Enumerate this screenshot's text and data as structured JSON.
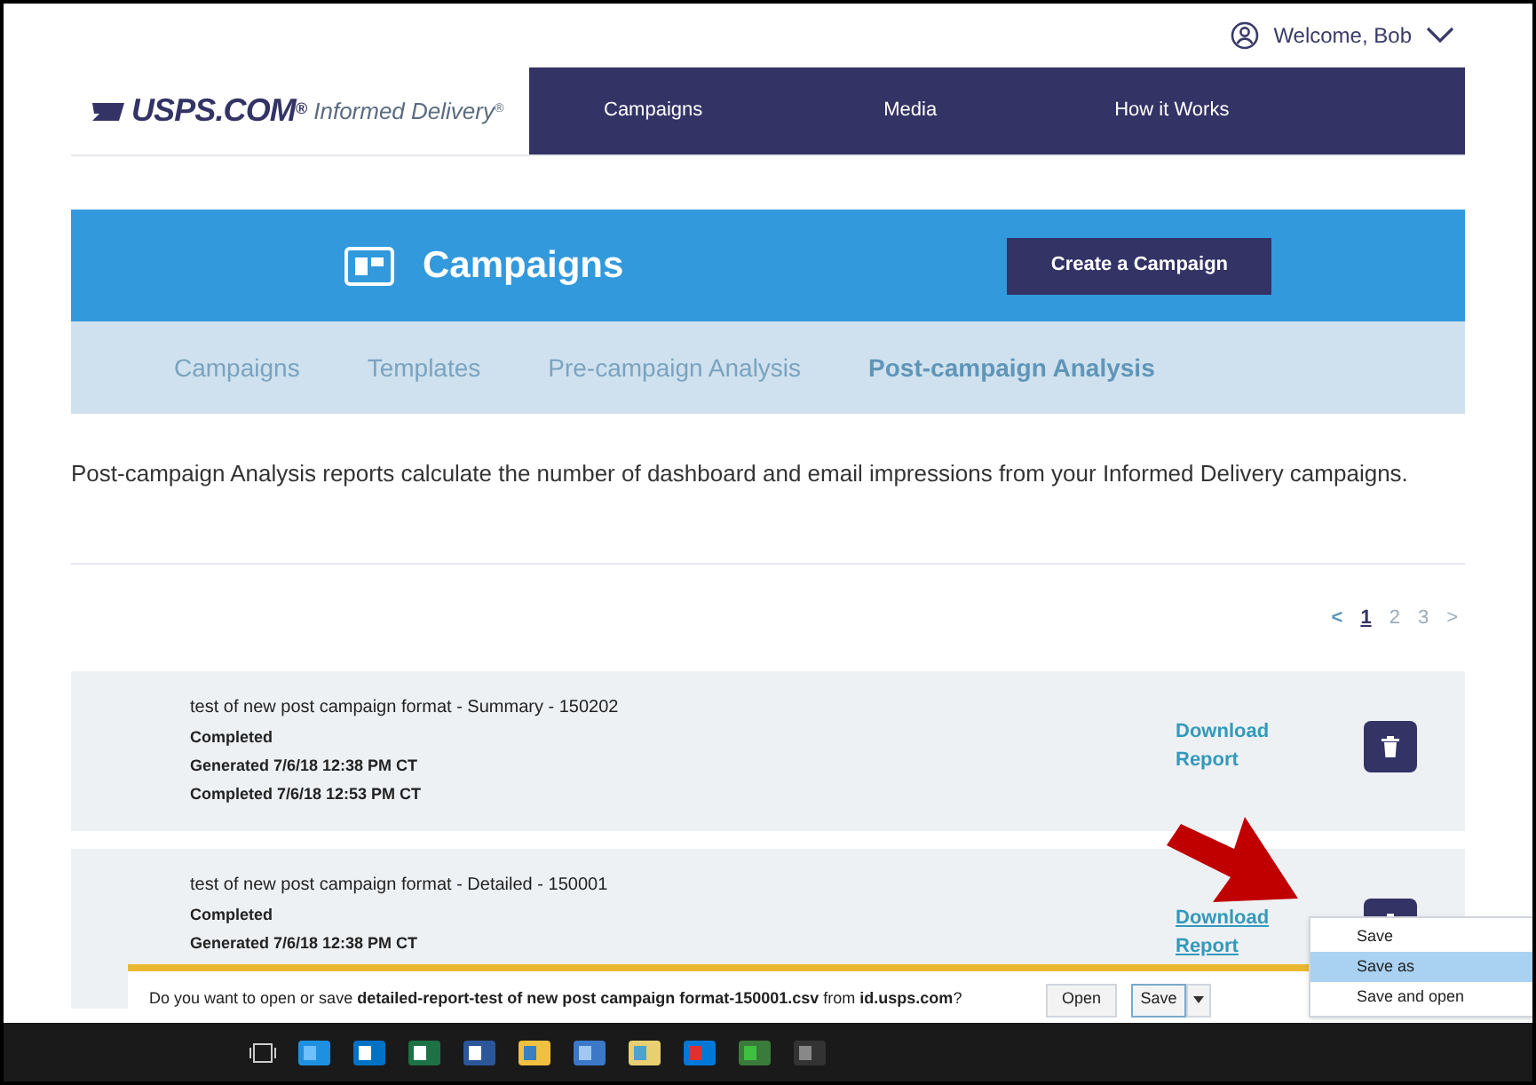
{
  "user_menu": {
    "label": "Welcome, Bob"
  },
  "logo": {
    "brand": "USPS.COM",
    "registered": "®",
    "product": "Informed Delivery",
    "product_mark": "®"
  },
  "nav": [
    {
      "label": "Campaigns"
    },
    {
      "label": "Media"
    },
    {
      "label": "How it Works"
    }
  ],
  "banner": {
    "title": "Campaigns",
    "button": "Create a Campaign"
  },
  "subtabs": [
    {
      "label": "Campaigns",
      "selected": false
    },
    {
      "label": "Templates",
      "selected": false
    },
    {
      "label": "Pre-campaign Analysis",
      "selected": false
    },
    {
      "label": "Post-campaign Analysis",
      "selected": true
    }
  ],
  "intro": "Post-campaign Analysis reports calculate the number of dashboard and email impressions from your Informed Delivery campaigns.",
  "pagination": {
    "prev": "<",
    "pages": [
      {
        "label": "1",
        "selected": true
      },
      {
        "label": "2",
        "selected": false
      },
      {
        "label": "3",
        "selected": false
      }
    ],
    "next": ">"
  },
  "reports": [
    {
      "title": "test of new post campaign format - Summary - 150202",
      "status": "Completed",
      "lines": [
        "Generated 7/6/18 12:38 PM CT",
        "Completed 7/6/18 12:53 PM CT"
      ],
      "link": "Download Report"
    },
    {
      "title": "test of new post campaign format - Detailed - 150001",
      "status": "Completed",
      "lines": [
        "Generated 7/6/18 12:38 PM CT"
      ],
      "link": "Download Report"
    }
  ],
  "download_bar": {
    "prompt": "Do you want to open or save ",
    "file": "detailed-report-test of new post campaign format-150001.csv",
    "from": " from ",
    "site": "id.usps.com",
    "suffix": "?",
    "open": "Open",
    "save": "Save"
  },
  "save_menu": [
    {
      "label": "Save",
      "selected": false
    },
    {
      "label": "Save as",
      "selected": true
    },
    {
      "label": "Save and open",
      "selected": false
    }
  ]
}
